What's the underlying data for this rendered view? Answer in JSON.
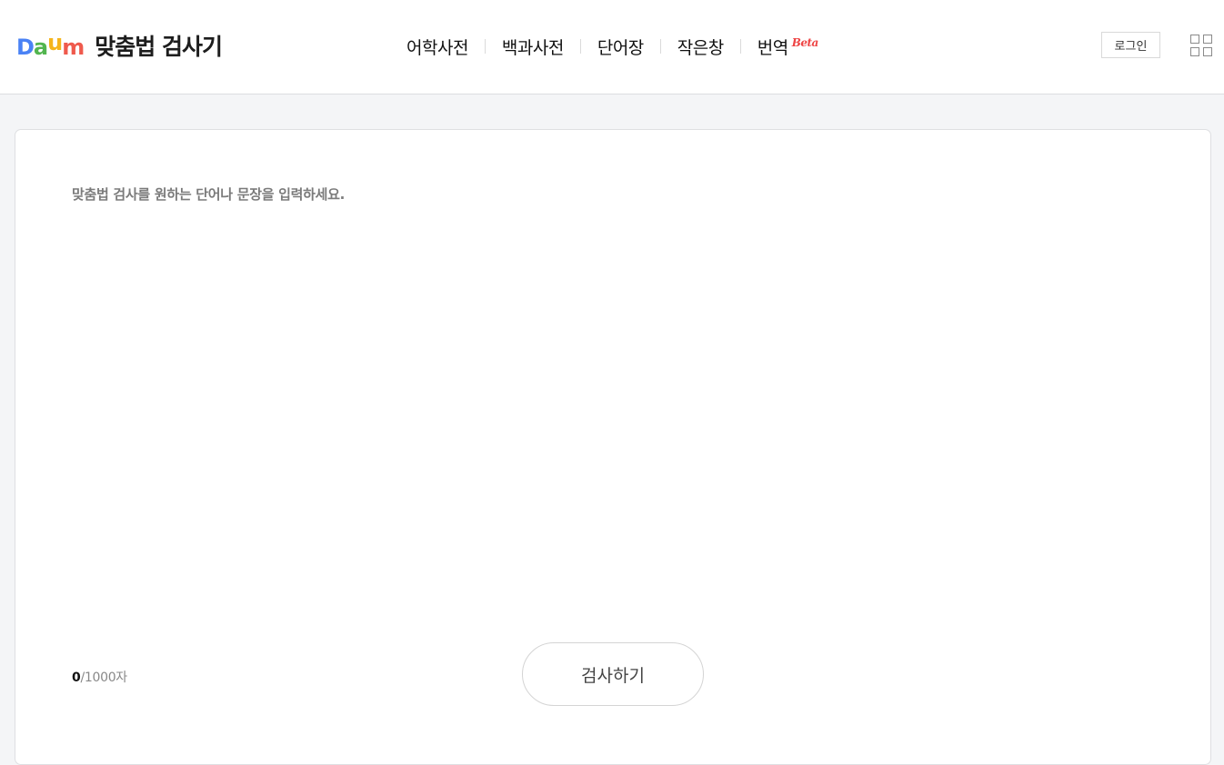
{
  "header": {
    "logo": {
      "letters": [
        "D",
        "a",
        "u",
        "m"
      ],
      "colors": [
        "#4a82f5",
        "#52b54f",
        "#f5b51d",
        "#ef5a4d"
      ]
    },
    "service_title": "맞춤법 검사기",
    "nav": [
      {
        "label": "어학사전"
      },
      {
        "label": "백과사전"
      },
      {
        "label": "단어장"
      },
      {
        "label": "작은창"
      },
      {
        "label": "번역",
        "badge": "Beta"
      }
    ],
    "login_label": "로그인",
    "apps_icon": "grid-icon"
  },
  "editor": {
    "value": "",
    "placeholder": "맞춤법 검사를 원하는 단어나 문장을 입력하세요.",
    "char_count": "0",
    "char_limit": "/1000자",
    "submit_label": "검사하기"
  },
  "colors": {
    "background": "#f4f5f7",
    "card": "#ffffff",
    "beta_badge": "#ee4444"
  }
}
